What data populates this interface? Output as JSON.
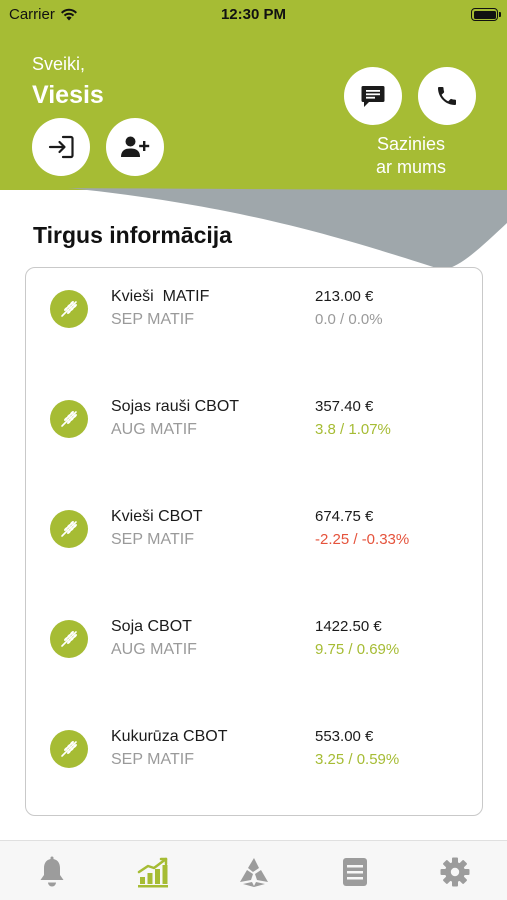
{
  "status_bar": {
    "carrier": "Carrier",
    "time": "12:30 PM"
  },
  "header": {
    "greeting": "Sveiki,",
    "username": "Viesis",
    "contact_label_line1": "Sazinies",
    "contact_label_line2": "ar mums"
  },
  "market": {
    "title": "Tirgus informācija",
    "items": [
      {
        "name": "Kvieši  MATIF",
        "market": "SEP MATIF",
        "price": "213.00 €",
        "change": "0.0 / 0.0%",
        "trend": "neutral"
      },
      {
        "name": "Sojas rauši CBOT",
        "market": "AUG MATIF",
        "price": "357.40 €",
        "change": "3.8 / 1.07%",
        "trend": "up"
      },
      {
        "name": "Kvieši CBOT",
        "market": "SEP MATIF",
        "price": "674.75 €",
        "change": "-2.25 / -0.33%",
        "trend": "down"
      },
      {
        "name": "Soja CBOT",
        "market": "AUG MATIF",
        "price": "1422.50 €",
        "change": "9.75 / 0.69%",
        "trend": "up"
      },
      {
        "name": "Kukurūza CBOT",
        "market": "SEP MATIF",
        "price": "553.00 €",
        "change": "3.25 / 0.59%",
        "trend": "up"
      }
    ]
  },
  "tab_bar": {
    "tabs": [
      {
        "icon": "bell-icon",
        "active": false
      },
      {
        "icon": "chart-icon",
        "active": true
      },
      {
        "icon": "logo-icon",
        "active": false
      },
      {
        "icon": "list-icon",
        "active": false
      },
      {
        "icon": "gear-icon",
        "active": false
      }
    ]
  },
  "colors": {
    "brand_green": "#a6bc34",
    "wave_grey": "#9fa7ab",
    "negative_red": "#e5533c",
    "muted_grey": "#9a9a9a",
    "tab_inactive": "#9c9c9c"
  }
}
